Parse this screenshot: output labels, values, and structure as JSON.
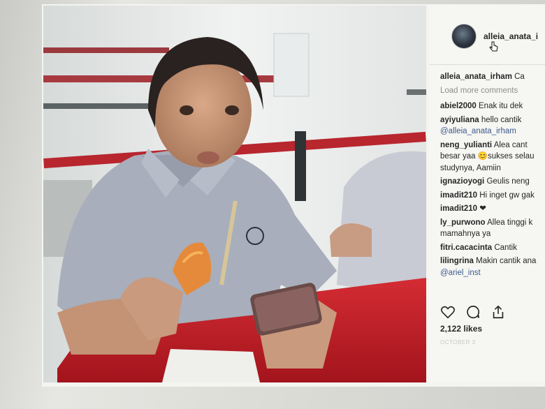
{
  "post": {
    "username_header": "alleia_anata_i",
    "likes": "2,122 likes",
    "date": "OCTOBER 3"
  },
  "comments": {
    "caption": {
      "user": "alleia_anata_irham",
      "text": "Ca"
    },
    "load_more": "Load more comments",
    "items": [
      {
        "user": "abiel2000",
        "text": "Enak itu dek",
        "line2": ""
      },
      {
        "user": "ayiyuliana",
        "text": "hello cantik",
        "line2": "@alleia_anata_irham"
      },
      {
        "user": "neng_yulianti",
        "text": "Alea cant",
        "line2": "besar yaa 😊sukses selau",
        "line3": "studynya, Aamiin"
      },
      {
        "user": "ignazioyogi",
        "text": "Geulis neng",
        "line2": ""
      },
      {
        "user": "imadit210",
        "text": "Hi inget gw gak",
        "line2": ""
      },
      {
        "user": "imadit210",
        "text": "❤",
        "line2": ""
      },
      {
        "user": "ly_purwono",
        "text": "Allea tinggi k",
        "line2": "mamahnya ya"
      },
      {
        "user": "fitri.cacacinta",
        "text": "Cantik",
        "line2": ""
      },
      {
        "user": "lilingrina",
        "text": "Makin cantik ana",
        "line2": "@ariel_inst"
      }
    ]
  },
  "icons": [
    "heart-icon",
    "comment-icon",
    "share-icon",
    "cursor-icon"
  ],
  "colors": {
    "mention": "#3b5b8c",
    "muted": "#8e8e8e",
    "text": "#262626",
    "table_red": "#c8202a"
  }
}
